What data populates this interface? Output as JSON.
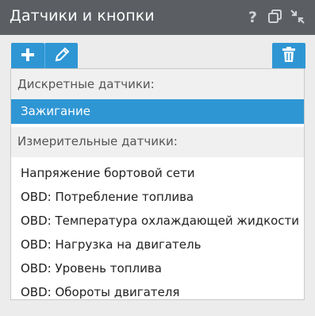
{
  "window": {
    "title": "Датчики и кнопки",
    "icons": [
      "help-icon",
      "copy-windows-icon",
      "collapse-icon"
    ]
  },
  "toolbar": {
    "buttons": [
      "plus-icon",
      "pencil-icon",
      "trash-icon"
    ],
    "accent_color": "#2f96d4"
  },
  "list": {
    "groups": [
      {
        "label": "Дискретные датчики:",
        "items": [
          "Зажигание"
        ],
        "selected": "Зажигание"
      },
      {
        "label": "Измерительные датчики:",
        "items": [
          "Напряжение бортовой сети",
          "OBD: Потребление топлива",
          "OBD: Температура охлаждающей жидкости",
          "OBD: Нагрузка на двигатель",
          "OBD: Уровень топлива",
          "OBD: Обороты двигателя"
        ]
      }
    ]
  }
}
